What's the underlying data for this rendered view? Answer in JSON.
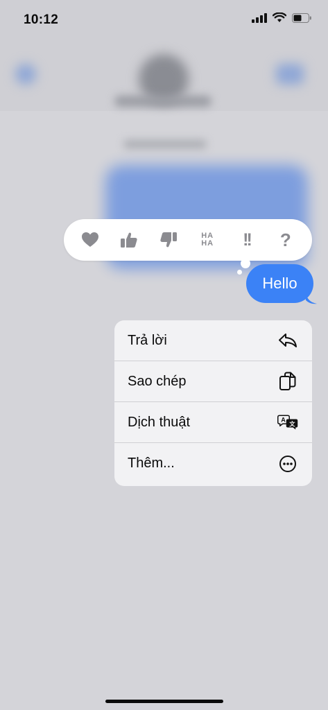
{
  "status_bar": {
    "time": "10:12"
  },
  "reactions": {
    "items": [
      {
        "name": "heart",
        "label": ""
      },
      {
        "name": "thumbs-up",
        "label": ""
      },
      {
        "name": "thumbs-down",
        "label": ""
      },
      {
        "name": "haha",
        "label_top": "HA",
        "label_bottom": "HA"
      },
      {
        "name": "emphasize",
        "label": "!!"
      },
      {
        "name": "question",
        "label": "?"
      }
    ]
  },
  "message": {
    "text": "Hello"
  },
  "menu": {
    "items": [
      {
        "label": "Trả lời",
        "icon": "reply-icon"
      },
      {
        "label": "Sao chép",
        "icon": "copy-icon"
      },
      {
        "label": "Dịch thuật",
        "icon": "translate-icon"
      },
      {
        "label": "Thêm...",
        "icon": "more-icon"
      }
    ]
  },
  "colors": {
    "accent": "#3b82f6",
    "background": "#d4d4d9",
    "menu_bg": "#f2f2f4"
  }
}
